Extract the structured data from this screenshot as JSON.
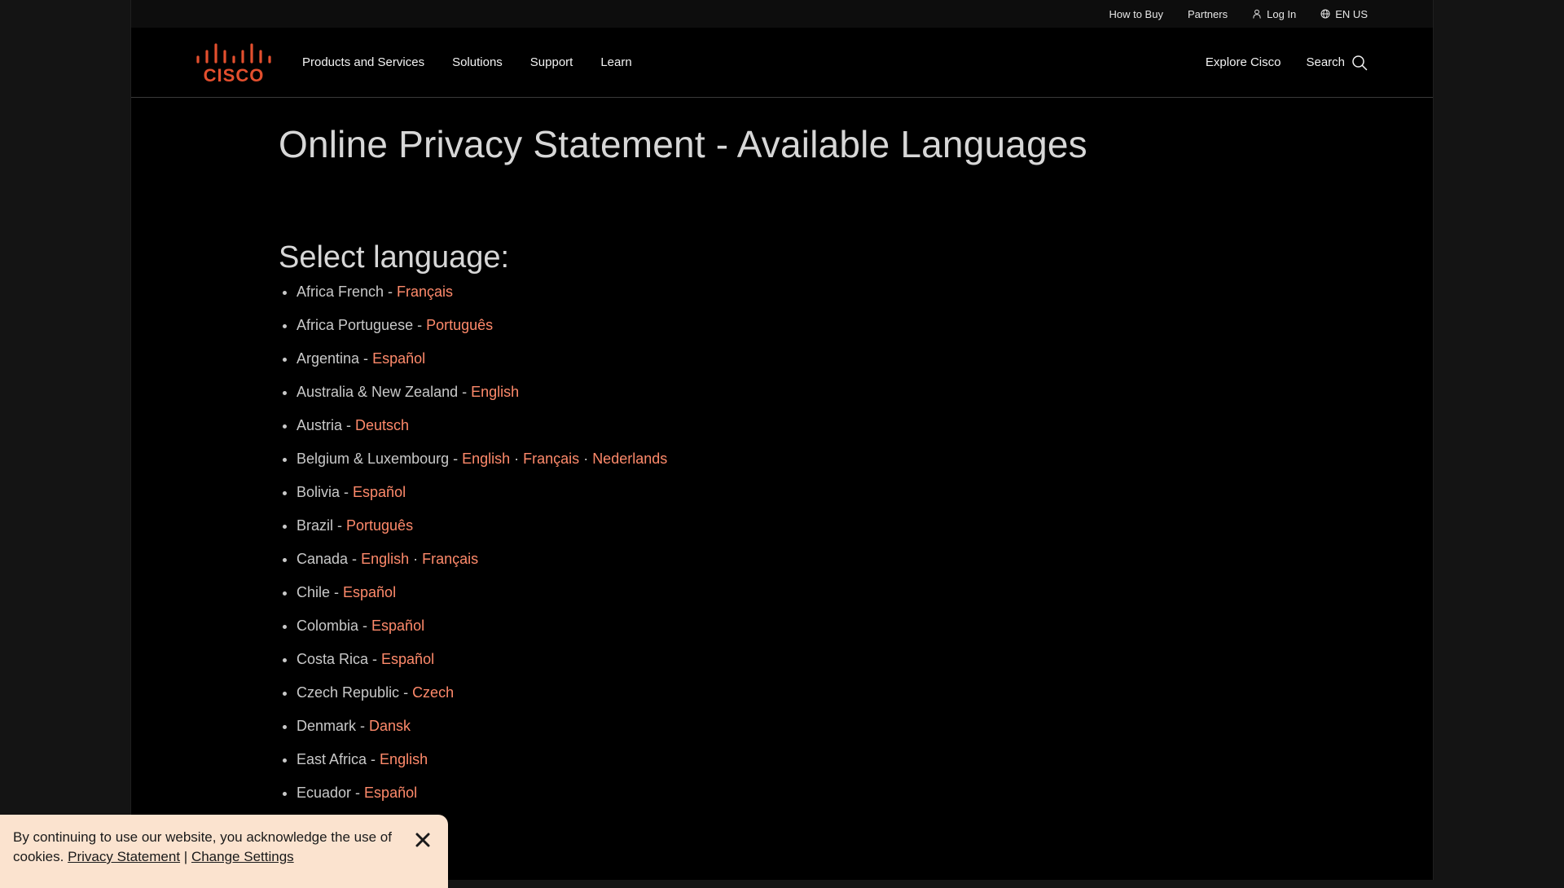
{
  "utility": {
    "how_to_buy": "How to Buy",
    "partners": "Partners",
    "log_in": "Log In",
    "locale": "EN US"
  },
  "nav": {
    "logo_text": "CISCO",
    "items": [
      "Products and Services",
      "Solutions",
      "Support",
      "Learn"
    ],
    "explore": "Explore Cisco",
    "search": "Search"
  },
  "colors": {
    "accent_link": "#ff8a6b",
    "brand_red": "#e34f2e",
    "cookie_bg": "#fbe3cf"
  },
  "page": {
    "title": "Online Privacy Statement - Available Languages",
    "section_heading": "Select language:"
  },
  "languages": [
    {
      "region": "Africa French - ",
      "links": [
        "Français"
      ]
    },
    {
      "region": "Africa Portuguese - ",
      "links": [
        "Português"
      ]
    },
    {
      "region": "Argentina - ",
      "links": [
        "Español"
      ]
    },
    {
      "region": "Australia & New Zealand - ",
      "links": [
        "English"
      ]
    },
    {
      "region": "Austria - ",
      "links": [
        "Deutsch"
      ]
    },
    {
      "region": "Belgium & Luxembourg - ",
      "links": [
        "English",
        "Français",
        "Nederlands"
      ]
    },
    {
      "region": "Bolivia - ",
      "links": [
        "Español"
      ]
    },
    {
      "region": "Brazil - ",
      "links": [
        "Português"
      ]
    },
    {
      "region": "Canada - ",
      "links": [
        "English",
        "Français"
      ]
    },
    {
      "region": "Chile - ",
      "links": [
        "Español"
      ]
    },
    {
      "region": "Colombia - ",
      "links": [
        "Español"
      ]
    },
    {
      "region": "Costa Rica - ",
      "links": [
        "Español"
      ]
    },
    {
      "region": "Czech Republic - ",
      "links": [
        "Czech"
      ]
    },
    {
      "region": "Denmark - ",
      "links": [
        "Dansk"
      ]
    },
    {
      "region": "East Africa - ",
      "links": [
        "English"
      ]
    },
    {
      "region": "Ecuador - ",
      "links": [
        "Español"
      ]
    }
  ],
  "link_separator": " · ",
  "cookie": {
    "text": "By continuing to use our website, you acknowledge the use of cookies.",
    "privacy_link": "Privacy Statement",
    "divider": "|",
    "settings_link": "Change Settings"
  }
}
